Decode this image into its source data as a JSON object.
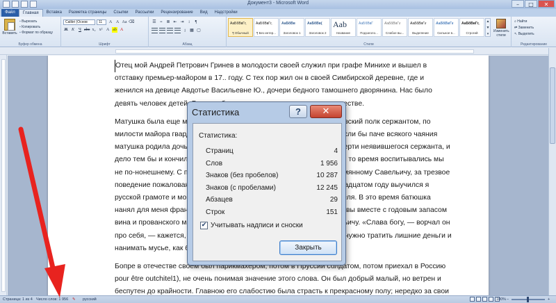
{
  "window": {
    "title": "Документ3 - Microsoft Word"
  },
  "tabs": [
    "Файл",
    "Главная",
    "Вставка",
    "Разметка страницы",
    "Ссылки",
    "Рассылки",
    "Рецензирование",
    "Вид",
    "Надстройки"
  ],
  "ribbon": {
    "clipboard": {
      "paste": "Вставить",
      "cut": "Вырезать",
      "copy": "Копировать",
      "format_painter": "Формат по образцу",
      "label": "Буфер обмена"
    },
    "font": {
      "name": "Calibri (Основ",
      "size": "11",
      "label": "Шрифт"
    },
    "paragraph": {
      "label": "Абзац"
    },
    "styles": {
      "label": "Стили",
      "items": [
        {
          "preview": "АаБбВвГг,",
          "name": "¶ Обычный"
        },
        {
          "preview": "АаБбВвГг,",
          "name": "¶ Без интер..."
        },
        {
          "preview": "АаБбВв",
          "name": "Заголовок 1"
        },
        {
          "preview": "АаБбВв(",
          "name": "Заголовок 2"
        },
        {
          "preview": "Aab",
          "name": "Название"
        },
        {
          "preview": "АаБбВвГ",
          "name": "Подзаголо..."
        },
        {
          "preview": "АаБбВвГг",
          "name": "Слабое вы..."
        },
        {
          "preview": "АаБбВвГг",
          "name": "Выделение"
        },
        {
          "preview": "АаБбВвГг",
          "name": "Сильное в..."
        },
        {
          "preview": "АаБбВвГг,",
          "name": "Строгий"
        }
      ],
      "change_styles": "Изменить стили"
    },
    "editing": {
      "find": "Найти",
      "replace": "Заменить",
      "select": "Выделить",
      "label": "Редактирование"
    }
  },
  "document": {
    "paragraphs": [
      [
        "Отец мой Андрей Петрович Гринев в молодости своей служил при графе Минихе и вышел в",
        "отставку премьер-майором в 17.. году. С тех пор жил он в своей Симбирской деревне, где и",
        "женился на девице Авдотье Васильевне Ю., дочери бедного тамошнего дворянина. Нас было",
        "девять человек детей. Все мои братья и сестры умерли во младенчестве."
      ],
      [
        "Матушка была еще мною брюхата, как уже я был записан в Семеновский полк сержантом, по",
        "милости майора гвардии князя Б., близкого нашего родственника. Если бы паче всякого чаяния",
        "матушка родила дочь, то батюшка объявил бы куда следовало о смерти неявившегося сержанта, и",
        "дело тем бы и кончилось. Я считался в отпуску до окончания наук. В то время воспитывались мы",
        "не по-нонешнему. С пятилетнего возраста отдан я был на руки стремянному Савельичу, за трезвое",
        "поведение пожалованному мне в дядьки. Под его надзором на двенадцатом году выучился я",
        "русской грамоте и мог очень здраво судить о свойствах борзого кобеля. В это время батюшка",
        "нанял для меня француза, мосье Бопре, которого выписали из Москвы вместе с годовым запасом",
        "вина и прованского масла. Приезд его сильно не понравился Савельичу. «Слава богу, — ворчал он",
        "про себя, — кажется, дитя умыто, причесано, накормлено. Куда как нужно тратить лишние деньги и",
        "нанимать мусье, как будто и своих людей не стало!»"
      ],
      [
        "Бопре в отечестве своем был парикмахером, потом в Пруссии солдатом, потом приехал в Россию",
        "pour être outchitel1), не очень понимая значение этого слова. Он был добрый малый, но ветрен и",
        "беспутен до крайности. Главною его слабостию была страсть к прекрасному полу; нередко за свои"
      ]
    ]
  },
  "statusbar": {
    "page": "Страница: 1 из 4",
    "words": "Число слов: 1 956",
    "language": "русский",
    "zoom": "100%"
  },
  "dialog": {
    "title": "Статистика",
    "help": "?",
    "close_glyph": "✕",
    "heading": "Статистика:",
    "rows": [
      {
        "label": "Страниц",
        "value": "4"
      },
      {
        "label": "Слов",
        "value": "1 956"
      },
      {
        "label": "Знаков (без пробелов)",
        "value": "10 287"
      },
      {
        "label": "Знаков (с пробелами)",
        "value": "12 245"
      },
      {
        "label": "Абзацев",
        "value": "29"
      },
      {
        "label": "Строк",
        "value": "151"
      }
    ],
    "checkbox_label": "Учитывать надписи и сноски",
    "checkbox_checked": true,
    "close_button": "Закрыть"
  },
  "annotation": {
    "arrow_color": "#e8231f"
  }
}
